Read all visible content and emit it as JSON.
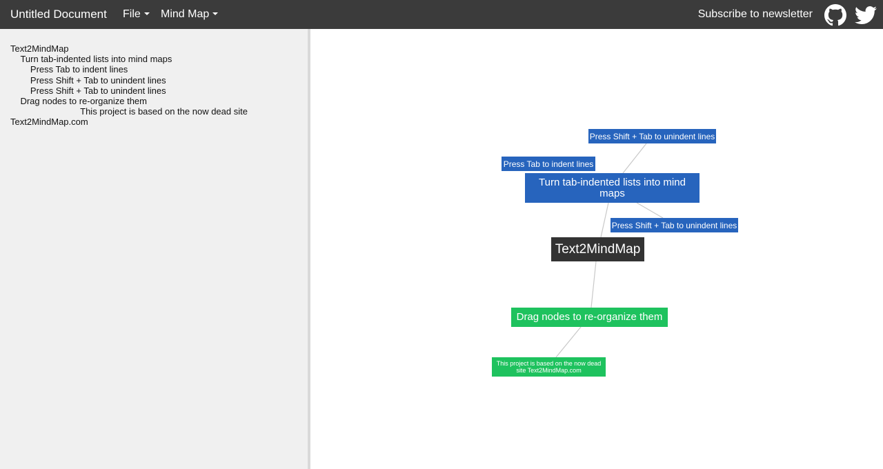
{
  "app": {
    "title": "Untitled Document"
  },
  "navbar": {
    "menus": [
      {
        "label": "File"
      },
      {
        "label": "Mind Map"
      }
    ],
    "subscribe_label": "Subscribe to newsletter",
    "icons": [
      "github-icon",
      "twitter-icon"
    ]
  },
  "editor": {
    "text": "Text2MindMap\n    Turn tab-indented lists into mind maps\n        Press Tab to indent lines\n        Press Shift + Tab to unindent lines\n        Press Shift + Tab to unindent lines\n    Drag nodes to re-organize them\n                            This project is based on the now dead site Text2MindMap.com"
  },
  "mindmap": {
    "root": "Text2MindMap",
    "branch_blue": "Turn tab-indented lists into mind maps",
    "blue_children": [
      "Press Tab to indent lines",
      "Press Shift + Tab to unindent lines",
      "Press Shift + Tab to unindent lines"
    ],
    "branch_green": "Drag nodes to re-organize them",
    "green_child": "This project is based on the now dead site Text2MindMap.com"
  },
  "colors": {
    "navbar": "#3b3b3b",
    "root_node": "#333333",
    "blue_node": "#2764bd",
    "green_node": "#1ec25e",
    "editor_bg": "#f0f0f0",
    "link": "#c8c8c8"
  }
}
